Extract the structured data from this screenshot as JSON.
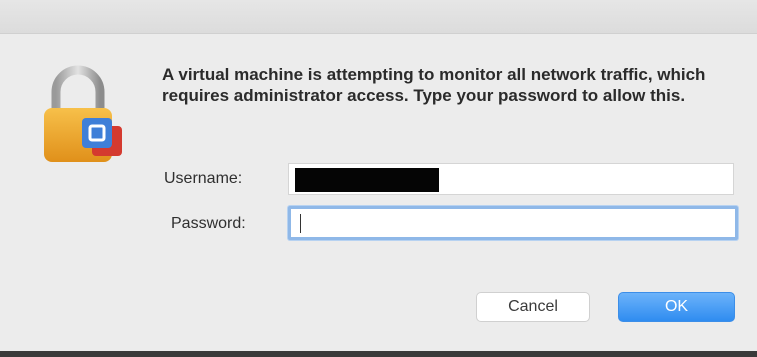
{
  "dialog": {
    "message": "A virtual machine is attempting to monitor all network traffic, which requires administrator access. Type your password to allow this.",
    "icon": "lock-icon"
  },
  "form": {
    "username_label": "Username:",
    "username_value_redacted": true,
    "password_label": "Password:",
    "password_value": ""
  },
  "buttons": {
    "cancel_label": "Cancel",
    "ok_label": "OK"
  },
  "colors": {
    "accent": "#2f8cf0",
    "focus_ring": "#8fb8e8",
    "lock_body": "#f0a928",
    "badge_blue": "#3f7fd8",
    "badge_red": "#d43a2f"
  }
}
